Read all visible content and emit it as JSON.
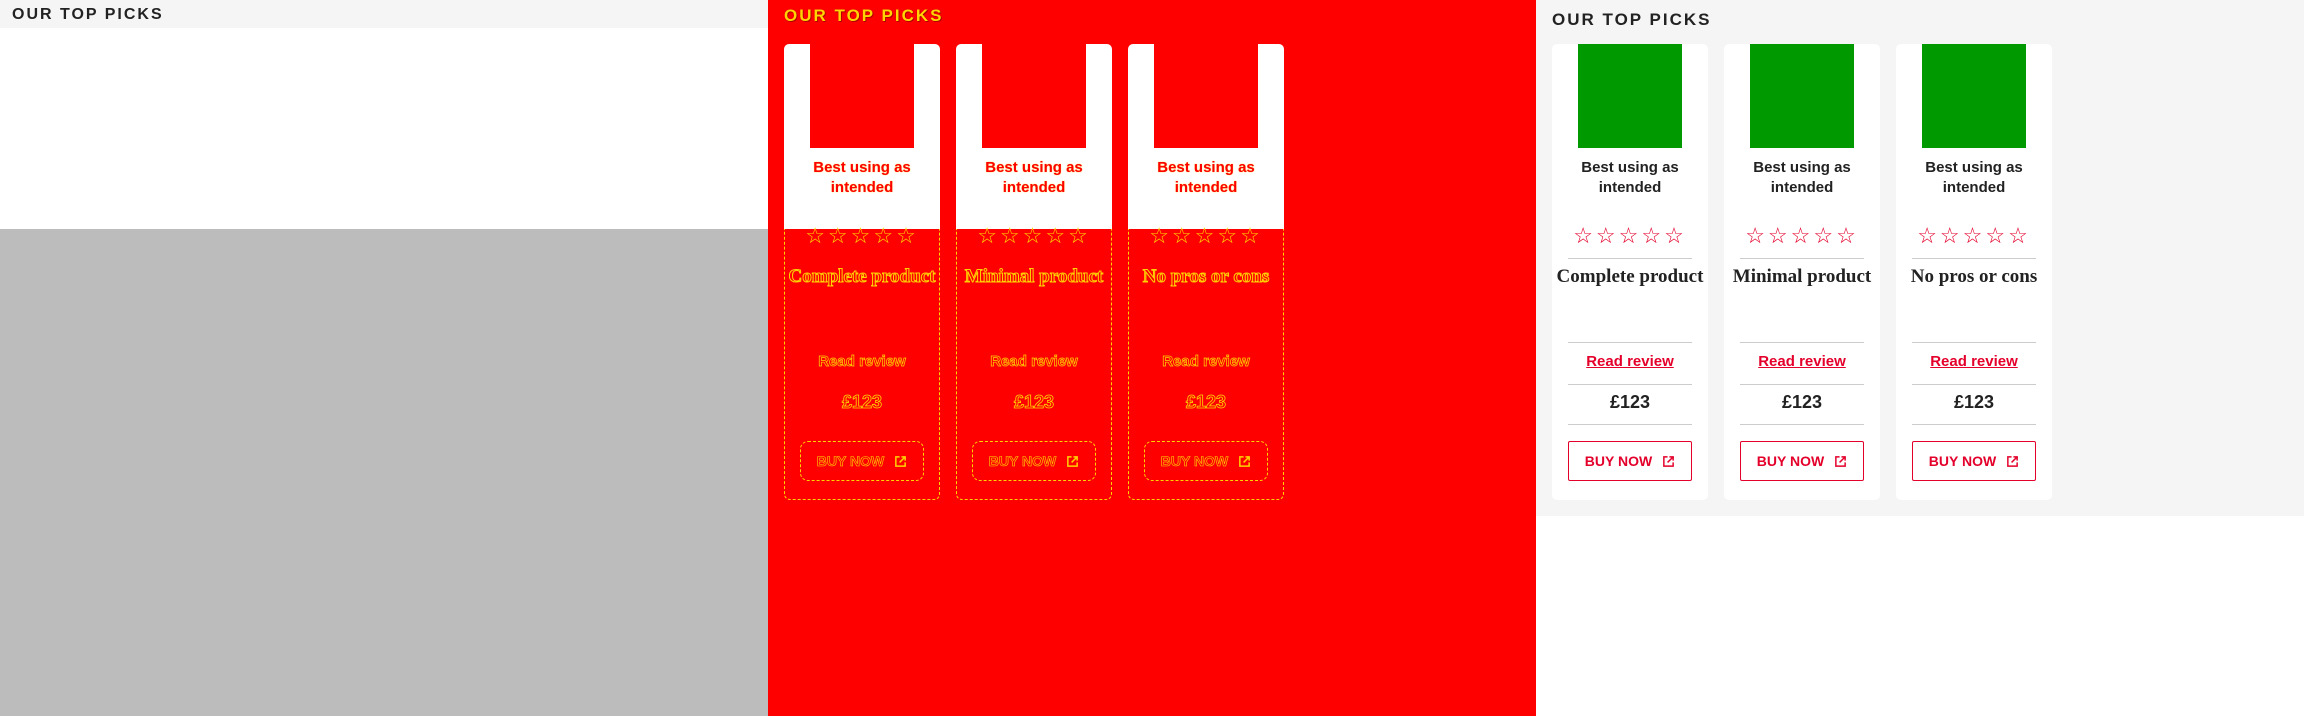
{
  "panes": [
    {
      "title": "OUR TOP PICKS"
    },
    {
      "title": "OUR TOP PICKS",
      "cards": [
        {
          "badge": "Best using as intended",
          "rating_stars": "☆☆☆☆☆",
          "name": "Complete product",
          "link_label": "Read review",
          "price": "£123",
          "button_label": "BUY NOW",
          "button_icon": "external-link-icon"
        },
        {
          "badge": "Best using as intended",
          "rating_stars": "☆☆☆☆☆",
          "name": "Minimal product",
          "link_label": "Read review",
          "price": "£123",
          "button_label": "BUY NOW",
          "button_icon": "external-link-icon"
        },
        {
          "badge": "Best using as intended",
          "rating_stars": "☆☆☆☆☆",
          "name": "No pros or cons",
          "link_label": "Read review",
          "price": "£123",
          "button_label": "BUY NOW",
          "button_icon": "external-link-icon"
        }
      ]
    },
    {
      "title": "OUR TOP PICKS",
      "cards": [
        {
          "badge": "Best using as intended",
          "rating_stars": "☆☆☆☆☆",
          "rating": 0,
          "rating_max": 5,
          "name": "Complete product",
          "link_label": "Read review",
          "price": "£123",
          "button_label": "BUY NOW",
          "button_icon": "external-link-icon"
        },
        {
          "badge": "Best using as intended",
          "rating_stars": "☆☆☆☆☆",
          "rating": 0,
          "rating_max": 5,
          "name": "Minimal product",
          "link_label": "Read review",
          "price": "£123",
          "button_label": "BUY NOW",
          "button_icon": "external-link-icon"
        },
        {
          "badge": "Best using as intended",
          "rating_stars": "☆☆☆☆☆",
          "rating": 0,
          "rating_max": 5,
          "name": "No pros or cons",
          "link_label": "Read review",
          "price": "£123",
          "button_label": "BUY NOW",
          "button_icon": "external-link-icon"
        }
      ]
    }
  ],
  "colors": {
    "brand_red": "#e4002b",
    "debug_red": "#ff0000",
    "debug_yellow": "#ffd400",
    "product_image_green": "#009900",
    "section_background": "#f5f5f5",
    "collapsed_grey": "#bcbcbc"
  }
}
